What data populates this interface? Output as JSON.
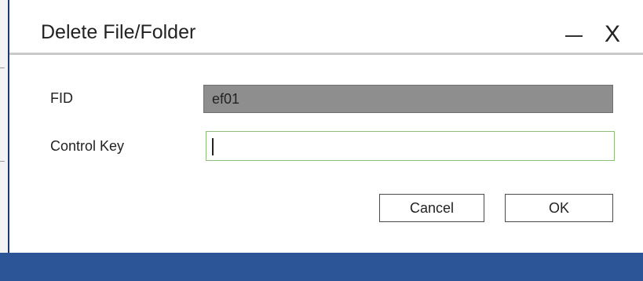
{
  "dialog": {
    "title": "Delete File/Folder",
    "minimize_icon": "minimize-icon",
    "close_icon": "close-icon",
    "close_glyph": "X"
  },
  "form": {
    "fid_label": "FID",
    "fid_value": "ef01",
    "control_key_label": "Control Key",
    "control_key_value": ""
  },
  "buttons": {
    "cancel_label": "Cancel",
    "ok_label": "OK"
  },
  "colors": {
    "accent": "#2b5597",
    "field_disabled": "#8e8e8e",
    "field_focus_border": "#8cbf7a"
  }
}
